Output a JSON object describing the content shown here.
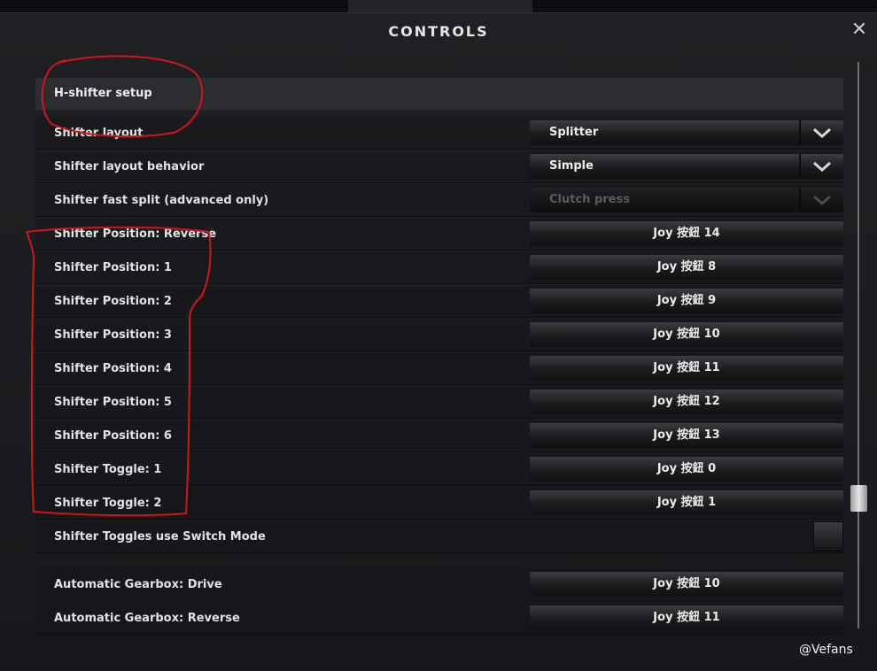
{
  "window": {
    "title": "CONTROLS",
    "close_glyph": "✕"
  },
  "section": {
    "label": "H-shifter setup"
  },
  "rows": [
    {
      "label": "Shifter layout",
      "type": "select",
      "value": "Splitter"
    },
    {
      "label": "Shifter layout behavior",
      "type": "select",
      "value": "Simple"
    },
    {
      "label": "Shifter fast split (advanced only)",
      "type": "select",
      "value": "Clutch press",
      "disabled": true
    },
    {
      "label": "Shifter Position: Reverse",
      "type": "bind",
      "value": "Joy 按鈕 14"
    },
    {
      "label": "Shifter Position: 1",
      "type": "bind",
      "value": "Joy 按鈕 8"
    },
    {
      "label": "Shifter Position: 2",
      "type": "bind",
      "value": "Joy 按鈕 9"
    },
    {
      "label": "Shifter Position: 3",
      "type": "bind",
      "value": "Joy 按鈕 10"
    },
    {
      "label": "Shifter Position: 4",
      "type": "bind",
      "value": "Joy 按鈕 11"
    },
    {
      "label": "Shifter Position: 5",
      "type": "bind",
      "value": "Joy 按鈕 12"
    },
    {
      "label": "Shifter Position: 6",
      "type": "bind",
      "value": "Joy 按鈕 13"
    },
    {
      "label": "Shifter Toggle: 1",
      "type": "bind",
      "value": "Joy 按鈕 0"
    },
    {
      "label": "Shifter Toggle: 2",
      "type": "bind",
      "value": "Joy 按鈕 1"
    },
    {
      "label": "Shifter Toggles use Switch Mode",
      "type": "checkbox",
      "checked": false
    },
    {
      "label": "Automatic Gearbox: Drive",
      "type": "bind",
      "value": "Joy 按鈕 10"
    },
    {
      "label": "Automatic Gearbox: Reverse",
      "type": "bind",
      "value": "Joy 按鈕 11"
    }
  ],
  "watermark": "@Vefans",
  "colors": {
    "annotation": "#d4141a",
    "panel": "#1e2023",
    "text": "#e2e2e2"
  }
}
